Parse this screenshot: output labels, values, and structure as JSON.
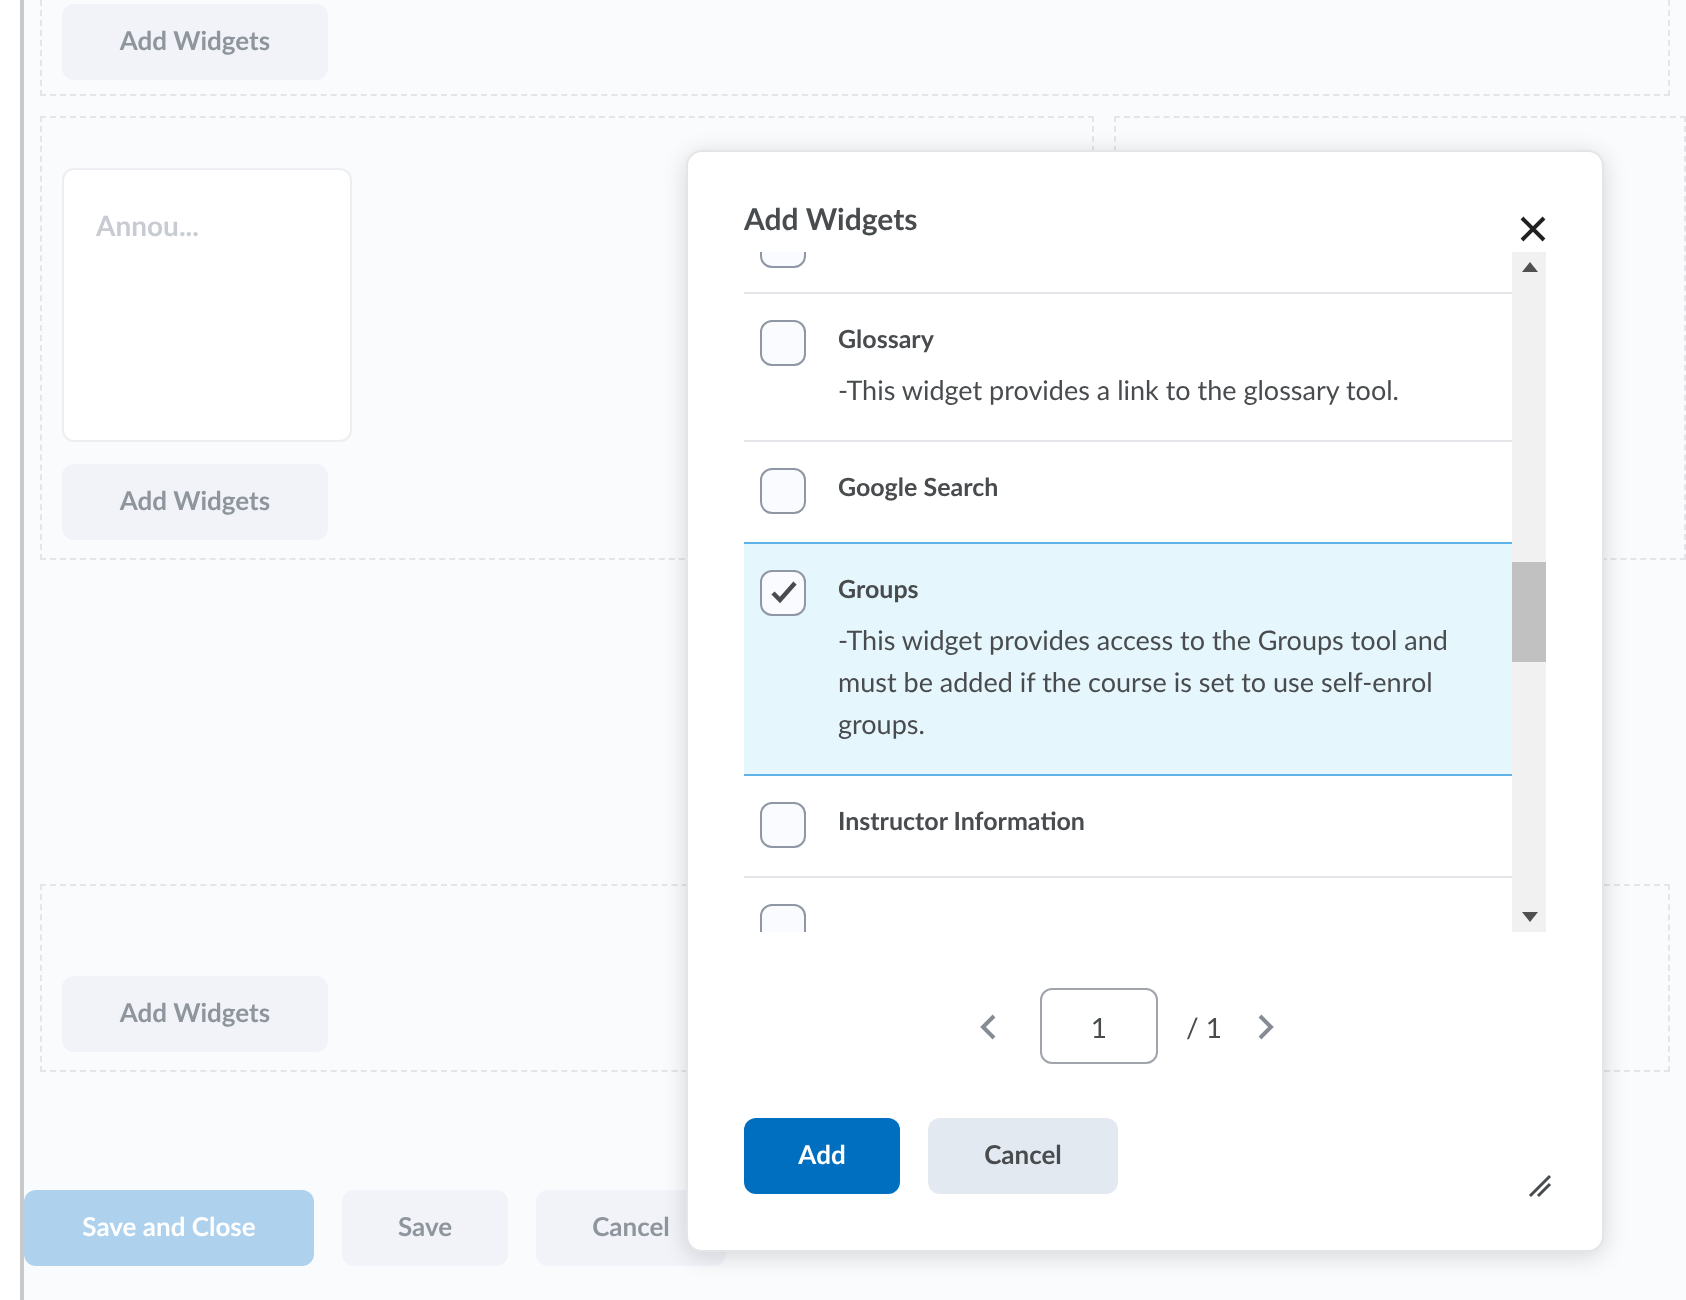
{
  "background": {
    "panels": [
      {
        "add_button": "Add Widgets"
      },
      {
        "widget": "Annou...",
        "add_button": "Add Widgets"
      },
      {
        "add_button": "Add Widgets"
      }
    ],
    "footer": {
      "buttons": [
        "Save and Close",
        "Save",
        "Cancel"
      ]
    }
  },
  "dialog": {
    "title": "Add Widgets",
    "items": [
      {
        "name": "Glossary",
        "description": "-This widget provides a link to the glossary tool.",
        "checked": false
      },
      {
        "name": "Google Search",
        "checked": false
      },
      {
        "name": "Groups",
        "description": "-This widget provides access to the Groups tool and must be added if the course is set to use self-enrol groups.",
        "checked": true
      },
      {
        "name": "Instructor Information",
        "checked": false
      }
    ],
    "partial_rows": [
      {
        "checked": false
      },
      {
        "checked": false
      }
    ],
    "pagination": {
      "page": "1",
      "total": "/ 1"
    },
    "buttons": {
      "primary": "Add",
      "secondary": "Cancel"
    }
  }
}
